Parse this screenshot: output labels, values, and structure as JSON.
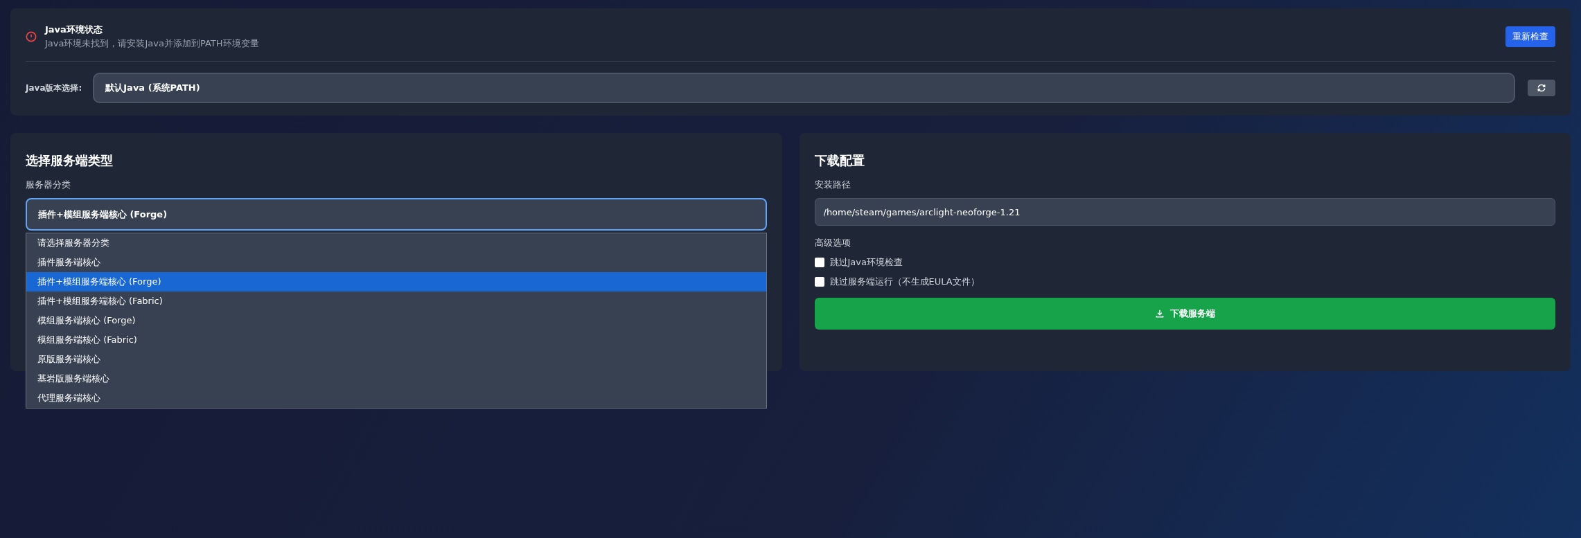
{
  "java_status": {
    "title": "Java环境状态",
    "message": "Java环境未找到，请安装Java并添加到PATH环境变量",
    "recheck_button": "重新检查"
  },
  "java_version": {
    "label": "Java版本选择:",
    "value": "默认Java (系统PATH)"
  },
  "server_type": {
    "title": "选择服务端类型",
    "category_label": "服务器分类",
    "category_value": "插件+模组服务端核心 (Forge)",
    "dropdown_open": true,
    "options": [
      {
        "label": "请选择服务器分类",
        "selected": false
      },
      {
        "label": "插件服务端核心",
        "selected": false
      },
      {
        "label": "插件+模组服务端核心 (Forge)",
        "selected": true
      },
      {
        "label": "插件+模组服务端核心 (Fabric)",
        "selected": false
      },
      {
        "label": "模组服务端核心 (Forge)",
        "selected": false
      },
      {
        "label": "模组服务端核心 (Fabric)",
        "selected": false
      },
      {
        "label": "原版服务端核心",
        "selected": false
      },
      {
        "label": "基岩版服务端核心",
        "selected": false
      },
      {
        "label": "代理服务端核心",
        "selected": false
      }
    ]
  },
  "download": {
    "title": "下载配置",
    "path_label": "安装路径",
    "path_value": "/home/steam/games/arclight-neoforge-1.21",
    "advanced_label": "高级选项",
    "options": [
      {
        "label": "跳过Java环境检查",
        "checked": false
      },
      {
        "label": "跳过服务端运行（不生成EULA文件）",
        "checked": false
      }
    ],
    "button": "下载服务端"
  }
}
